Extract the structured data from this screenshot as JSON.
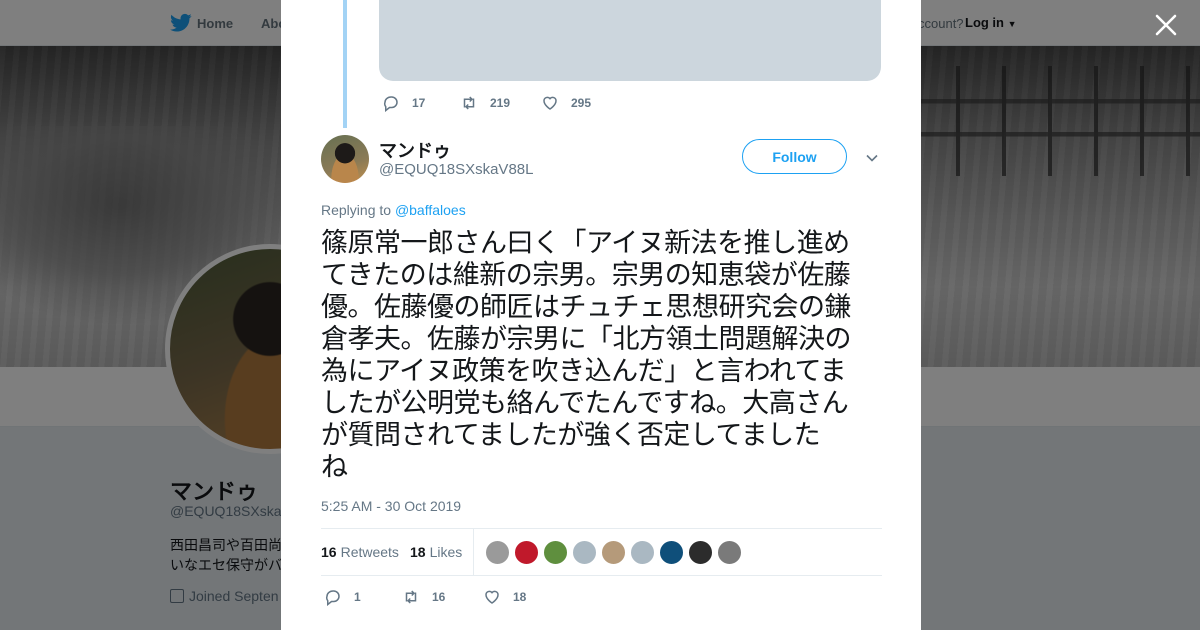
{
  "nav": {
    "home": "Home",
    "about": "Abo",
    "have_account": "ccount?",
    "login": "Log in"
  },
  "profile": {
    "name": "マンドゥ",
    "handle": "@EQUQ18SXska",
    "bio_line1": "西田昌司や百田尚",
    "bio_line2": "いなエセ保守がバ",
    "joined": "Joined Septen"
  },
  "parent_tweet": {
    "replies": "17",
    "retweets": "219",
    "likes": "295"
  },
  "tweet": {
    "author_name": "マンドゥ",
    "author_handle": "@EQUQ18SXskaV88L",
    "follow_label": "Follow",
    "replying_to_label": "Replying to",
    "replying_to_handle": "@baffaloes",
    "lines": [
      "篠原常一郎さん曰く「アイヌ新法を推し進め",
      "てきたのは維新の宗男。宗男の知恵袋が佐藤",
      "優。佐藤優の師匠はチュチェ思想研究会の鎌",
      "倉孝夫。佐藤が宗男に「北方領土問題解決の",
      "為にアイヌ政策を吹き込んだ」と言われてま",
      "したが公明党も絡んでたんですね。大高さん",
      "が質問されてましたが強く否定してました",
      "ね"
    ],
    "timestamp": "5:25 AM - 30 Oct 2019",
    "retweet_count": "16",
    "retweet_label": "Retweets",
    "like_count": "18",
    "like_label": "Likes",
    "replies": "1",
    "retweets": "16",
    "likes": "18"
  },
  "liker_colors": [
    "#9a9a9a",
    "#c0192b",
    "#5f8f3e",
    "#aab8c2",
    "#b59a7a",
    "#aab8c2",
    "#0f4f7a",
    "#2c2c2c",
    "#7a7a7a"
  ],
  "colors": {
    "accent": "#1da1f2",
    "thread_line": "#a3d3f5",
    "secondary_text": "#657786"
  },
  "icons": [
    "twitter-bird-icon",
    "close-icon",
    "reply-icon",
    "retweet-icon",
    "heart-icon",
    "chevron-down-icon",
    "calendar-icon"
  ]
}
